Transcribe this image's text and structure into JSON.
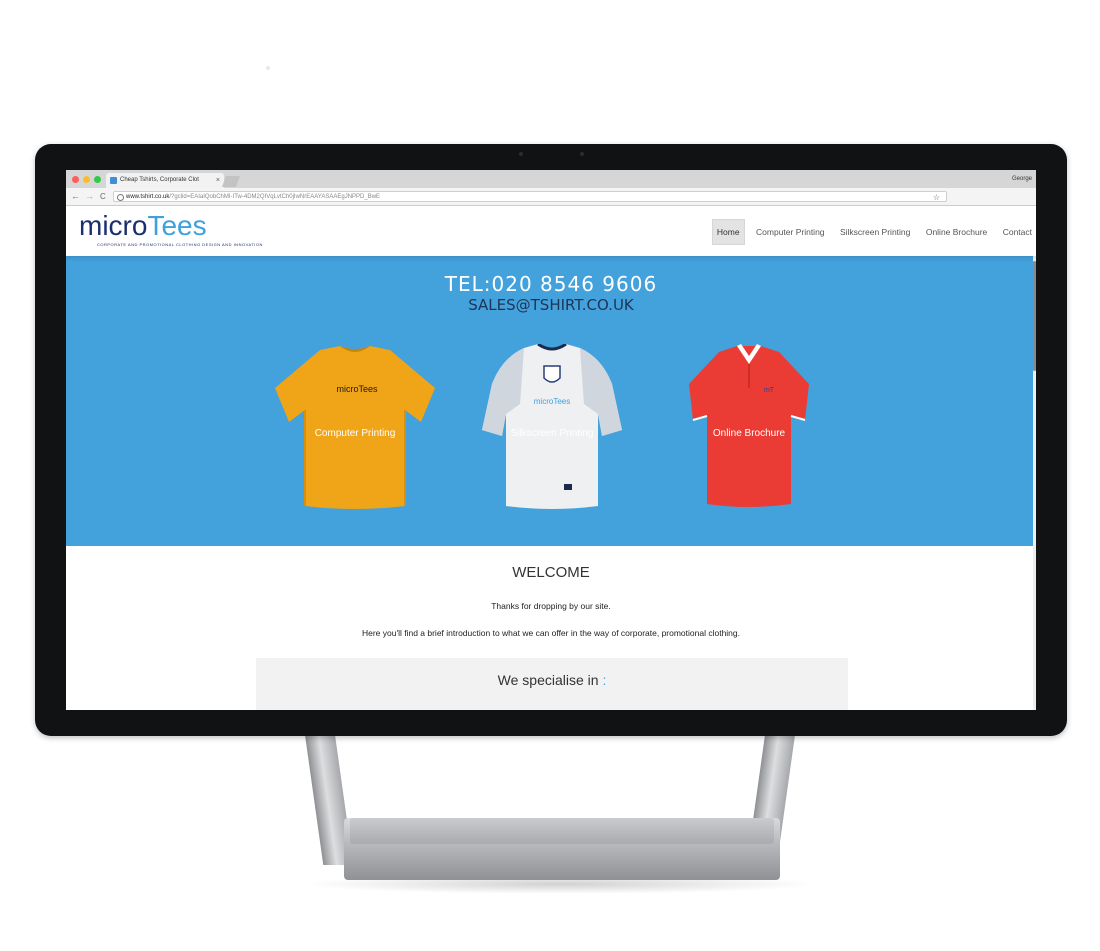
{
  "browser": {
    "tab_title": "Cheap Tshirts, Corporate Clot",
    "tab_close": "×",
    "user_name": "George",
    "url_domain": "www.tshirt.co.uk",
    "url_rest": "/?gclid=EAIaIQobChMI-ITw-4DM2QIVqLvtCh0jIwNrEAAYASAAEgJNPPD_BwE",
    "back": "←",
    "forward": "→",
    "reload": "C",
    "star": "☆"
  },
  "site": {
    "logo_micro": "micro",
    "logo_tees": "Tees",
    "logo_tagline": "CORPORATE AND PROMOTIONAL CLOTHING DESIGN AND INNOVATION",
    "nav": [
      {
        "label": "Home",
        "active": true
      },
      {
        "label": "Computer Printing"
      },
      {
        "label": "Silkscreen Printing"
      },
      {
        "label": "Online Brochure"
      },
      {
        "label": "Contact"
      }
    ]
  },
  "hero": {
    "tel": "TEL:020 8546 9606",
    "email": "SALES@TSHIRT.CO.UK",
    "products": [
      {
        "label": "Computer Printing",
        "image": "yellow-tshirt",
        "print": "microTees"
      },
      {
        "label": "Silkscreen Printing",
        "image": "white-football-shirt",
        "print": "microTees"
      },
      {
        "label": "Online Brochure",
        "image": "red-polo-shirt",
        "print": "mT"
      }
    ],
    "colors": {
      "background": "#43a1dc",
      "yellow": "#f0a417",
      "red": "#ea3c34",
      "white": "#eef0f2"
    }
  },
  "content": {
    "welcome": "WELCOME",
    "para1": "Thanks for dropping by our site.",
    "para2": "Here you'll find a brief introduction to what we can offer in the way of corporate, promotional clothing.",
    "special_title": "We specialise in",
    "special_colon": ":"
  }
}
